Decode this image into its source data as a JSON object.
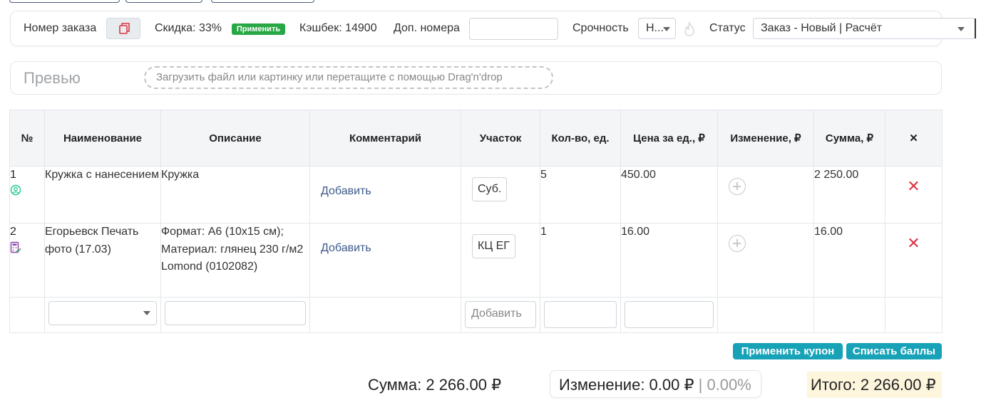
{
  "header": {
    "order_number_label": "Номер заказа",
    "discount_label": "Скидка: 33%",
    "apply_badge": "Применить",
    "cashback_label": "Кэшбек: 14900",
    "extra_numbers_label": "Доп. номера",
    "extra_numbers_value": "",
    "urgency_label": "Срочность",
    "urgency_value": "Н...",
    "status_label": "Статус",
    "status_value": "Заказ - Новый | Расчёт"
  },
  "preview": {
    "title": "Превью",
    "dropzone_text": "Загрузить файл или картинку или перетащите с помощью Drag'n'drop"
  },
  "table": {
    "headers": [
      "№",
      "Наименование",
      "Описание",
      "Комментарий",
      "Участок",
      "Кол-во, ед.",
      "Цена за ед., ₽",
      "Изменение, ₽",
      "Сумма, ₽",
      "✕"
    ],
    "rows": [
      {
        "num": "1",
        "icon": "user-circle-icon",
        "name": "Кружка с нанесением",
        "description": "Кружка",
        "comment_link": "Добавить",
        "section": "Суб.",
        "qty": "5",
        "price": "450.00",
        "sum": "2 250.00"
      },
      {
        "num": "2",
        "icon": "calculator-check-icon",
        "name": "Егорьевск Печать фото (17.03)",
        "description": "Формат: А6 (10х15 см); Материал: глянец 230 г/м2 Lomond (0102082)",
        "comment_link": "Добавить",
        "section": "КЦ ЕГ",
        "qty": "1",
        "price": "16.00",
        "sum": "16.00"
      }
    ],
    "new_row": {
      "section_placeholder": "Добавить"
    }
  },
  "actions": {
    "apply_coupon": "Применить купон",
    "write_off_points": "Списать баллы"
  },
  "totals": {
    "sum_text": "Сумма: 2 266.00 ₽",
    "change_text": "Изменение: 0.00 ₽",
    "change_separator": "|",
    "change_percent": "0.00%",
    "total_text": "Итого: 2 266.00 ₽"
  },
  "colors": {
    "accent_teal": "#17a2b8",
    "apply_green": "#28a745",
    "delete_red": "#dc3545",
    "total_bg": "#fdf5dc"
  }
}
